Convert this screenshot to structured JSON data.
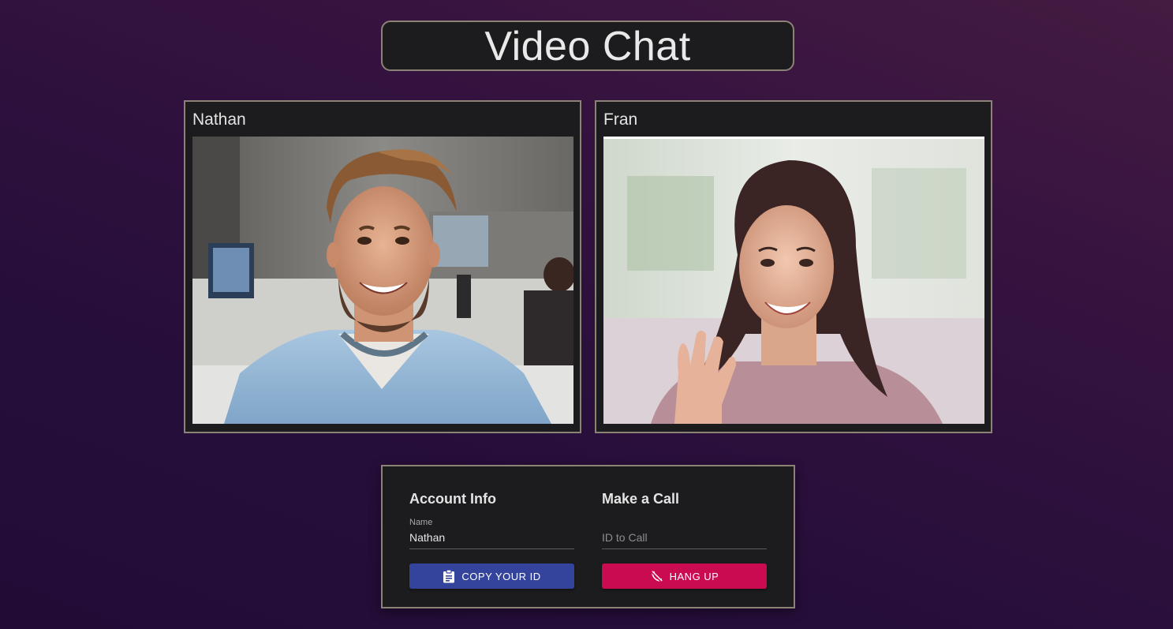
{
  "header": {
    "title": "Video Chat"
  },
  "videos": [
    {
      "name": "Nathan"
    },
    {
      "name": "Fran"
    }
  ],
  "account": {
    "heading": "Account Info",
    "name_label": "Name",
    "name_value": "Nathan",
    "copy_button_label": "COPY YOUR ID",
    "copy_icon": "clipboard-icon"
  },
  "call": {
    "heading": "Make a Call",
    "id_placeholder": "ID to Call",
    "id_value": "",
    "hangup_button_label": "HANG UP",
    "hangup_icon": "phone-disabled-icon"
  },
  "colors": {
    "copy_button": "#34449c",
    "hangup_button": "#ca0b51",
    "panel_background": "#1c1c1e",
    "panel_border": "#8c8275"
  }
}
